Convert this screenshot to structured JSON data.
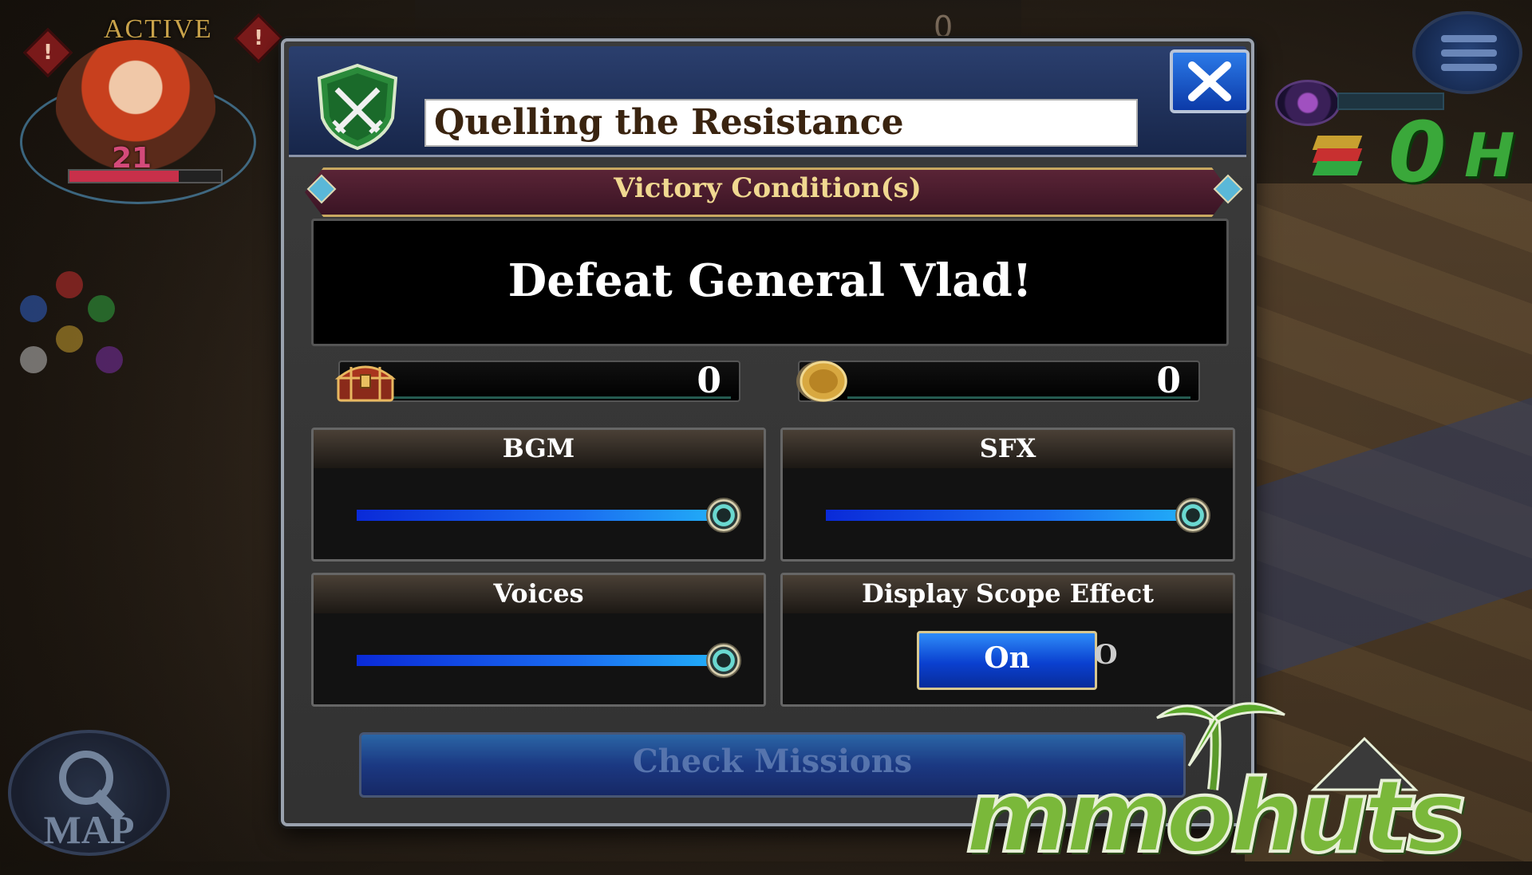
{
  "hud": {
    "active_label": "ACTIVE",
    "level": "21",
    "hp_fraction": 0.72,
    "map_label": "MAP",
    "top_counter": "0",
    "resource_count": "0",
    "currency_symbol": "H"
  },
  "dialog": {
    "title": "Quelling the Resistance",
    "victory_header": "Victory Condition(s)",
    "objective": "Defeat General Vlad!",
    "rewards": {
      "chest_count": "0",
      "coin_count": "0"
    },
    "settings": {
      "bgm": {
        "label": "BGM",
        "value": 1.0
      },
      "sfx": {
        "label": "SFX",
        "value": 1.0
      },
      "voices": {
        "label": "Voices",
        "value": 1.0
      },
      "scope": {
        "label": "Display Scope Effect",
        "on_label": "On",
        "off_label_peek": "O"
      }
    },
    "check_missions_label": "Check Missions"
  },
  "watermark": {
    "text": "mmohuts"
  },
  "colors": {
    "accent_blue": "#1a6cf0",
    "header_blue": "#2b3f6e",
    "victory_banner": "#5a2436",
    "gold_text": "#f0d890",
    "hud_green": "#3aa83a"
  },
  "icons": {
    "dialog_emblem": "crossed-swords-shield-icon",
    "close": "close-icon",
    "chest": "treasure-chest-icon",
    "coin": "gold-coin-icon",
    "menu": "menu-icon",
    "map": "magnifier-icon"
  }
}
